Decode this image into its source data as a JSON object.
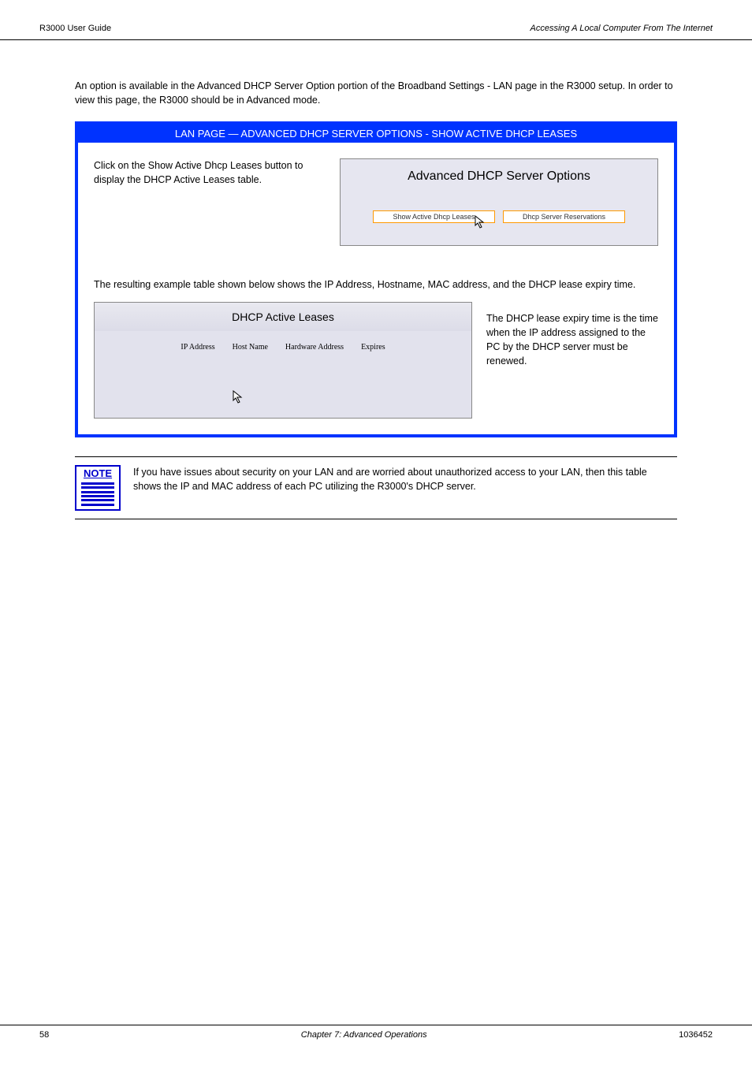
{
  "header": {
    "left": "R3000 User Guide",
    "right": "Accessing A Local Computer From The Internet"
  },
  "intro": "An option is available in the Advanced DHCP Server Option portion of the Broadband Settings - LAN page in the R3000 setup. In order to view this page, the R3000 should be in Advanced mode.",
  "panel": {
    "title": "LAN PAGE — ADVANCED DHCP SERVER OPTIONS - SHOW ACTIVE DHCP LEASES",
    "section1_para": "Click on the Show Active Dhcp Leases button to display the DHCP Active Leases table.",
    "options_box": {
      "title": "Advanced DHCP Server Options",
      "btn_left": "Show Active Dhcp Leases",
      "btn_right": "Dhcp Server Reservations"
    },
    "leases_intro": "The resulting example table shown below shows the IP Address, Hostname, MAC address, and the DHCP lease expiry time.",
    "leases_box": {
      "title": "DHCP Active Leases",
      "columns": [
        "IP Address",
        "Host Name",
        "Hardware Address",
        "Expires"
      ]
    },
    "lease_note": "The DHCP lease expiry time is the time when the IP address assigned to the PC by the DHCP server must be renewed."
  },
  "note": {
    "label": "NOTE",
    "text": "If you have issues about security on your LAN and are worried about unauthorized access to your LAN, then this table shows the IP and MAC address of each PC utilizing the R3000's DHCP server."
  },
  "footer": {
    "page": "58",
    "center": "Chapter 7: Advanced Operations",
    "doc": "1036452"
  }
}
